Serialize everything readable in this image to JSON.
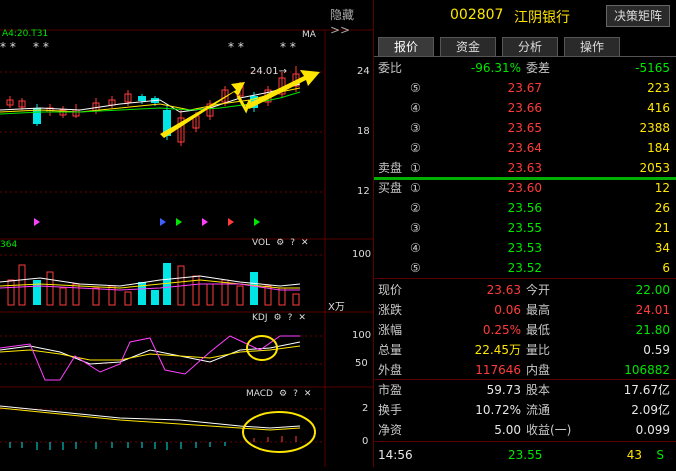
{
  "left_panel": {
    "hide_label": "隐藏>>",
    "main_header": "A4:20.T31",
    "ma_label": "MA",
    "price_marker": "24.01→",
    "stars": [
      "* *",
      "* *",
      "* *",
      "* *"
    ],
    "y_axis_main": [
      "24",
      "18",
      "12"
    ],
    "vol_header": "364",
    "vol_label": "VOL",
    "vol_axis": [
      "100"
    ],
    "vol_unit": "X万",
    "kdj_label": "KDJ",
    "kdj_axis": [
      "100",
      "50"
    ],
    "macd_label": "MACD",
    "macd_axis": [
      "2",
      "0"
    ]
  },
  "right_panel": {
    "code": "002807",
    "name": "江阴银行",
    "decision_button": "决策矩阵",
    "tabs": [
      "报价",
      "资金",
      "分析",
      "操作"
    ],
    "weibi_label": "委比",
    "weibi_value": "-96.31%",
    "weicha_label": "委差",
    "weicha_value": "-5165",
    "sell_label": "卖盘",
    "buy_label": "买盘",
    "sell_orders": [
      {
        "level": "⑤",
        "price": "23.67",
        "vol": "223"
      },
      {
        "level": "④",
        "price": "23.66",
        "vol": "416"
      },
      {
        "level": "③",
        "price": "23.65",
        "vol": "2388"
      },
      {
        "level": "②",
        "price": "23.64",
        "vol": "184"
      },
      {
        "level": "①",
        "price": "23.63",
        "vol": "2053"
      }
    ],
    "buy_orders": [
      {
        "level": "①",
        "price": "23.60",
        "vol": "12"
      },
      {
        "level": "②",
        "price": "23.56",
        "vol": "26"
      },
      {
        "level": "③",
        "price": "23.55",
        "vol": "21"
      },
      {
        "level": "④",
        "price": "23.53",
        "vol": "34"
      },
      {
        "level": "⑤",
        "price": "23.52",
        "vol": "6"
      }
    ],
    "stats": [
      {
        "l1": "现价",
        "v1": "23.63",
        "c1": "red",
        "l2": "今开",
        "v2": "22.00",
        "c2": "grn"
      },
      {
        "l1": "涨跌",
        "v1": "0.06",
        "c1": "red",
        "l2": "最高",
        "v2": "24.01",
        "c2": "red"
      },
      {
        "l1": "涨幅",
        "v1": "0.25%",
        "c1": "red",
        "l2": "最低",
        "v2": "21.80",
        "c2": "grn"
      },
      {
        "l1": "总量",
        "v1": "22.45万",
        "c1": "yel",
        "l2": "量比",
        "v2": "0.59",
        "c2": "wht"
      },
      {
        "l1": "外盘",
        "v1": "117646",
        "c1": "red",
        "l2": "内盘",
        "v2": "106882",
        "c2": "grn"
      }
    ],
    "stats2": [
      {
        "l1": "市盈",
        "v1": "59.73",
        "l2": "股本",
        "v2": "17.67亿"
      },
      {
        "l1": "换手",
        "v1": "10.72%",
        "l2": "流通",
        "v2": "2.09亿"
      },
      {
        "l1": "净资",
        "v1": "5.00",
        "l2": "收益(一)",
        "v2": "0.099"
      }
    ],
    "tick": {
      "time": "14:56",
      "price": "23.55",
      "vol": "43",
      "side": "S"
    }
  }
}
